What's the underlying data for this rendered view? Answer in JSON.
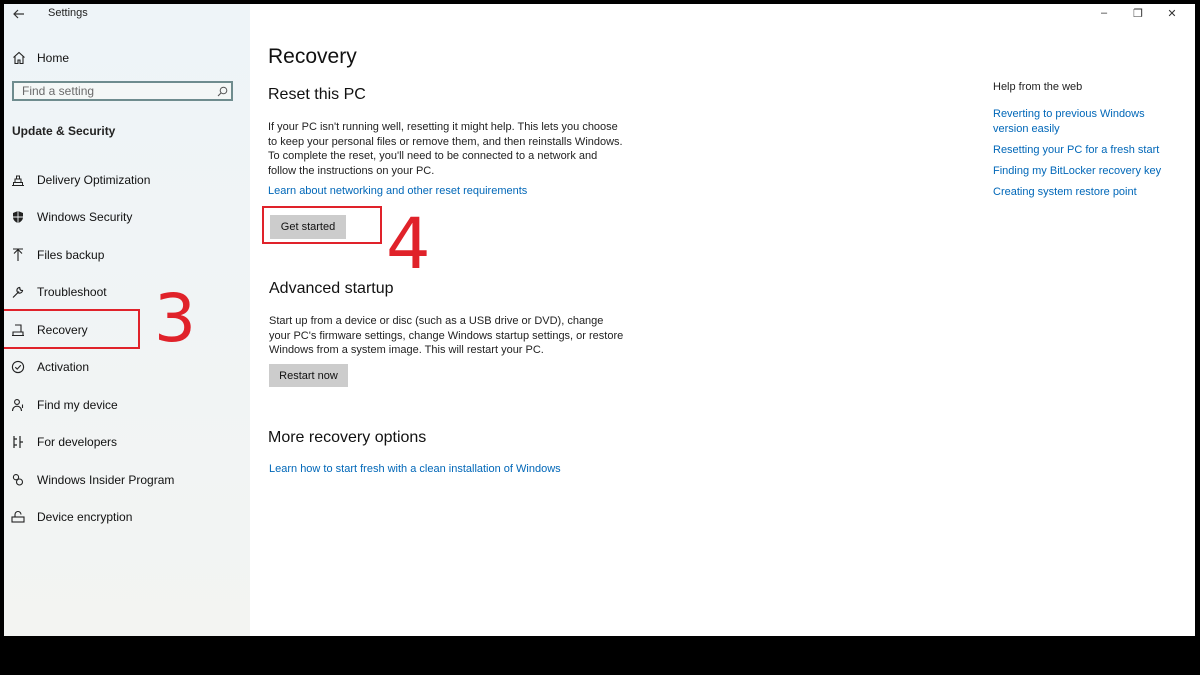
{
  "window": {
    "title": "Settings",
    "controls": [
      "–",
      "❐",
      "✕"
    ]
  },
  "sidebar": {
    "home_label": "Home",
    "search_placeholder": "Find a setting",
    "section_title": "Update & Security",
    "items": [
      {
        "label": "Delivery Optimization",
        "icon": "delivery-icon"
      },
      {
        "label": "Windows Security",
        "icon": "shield-icon"
      },
      {
        "label": "Files backup",
        "icon": "backup-arrow-icon"
      },
      {
        "label": "Troubleshoot",
        "icon": "wrench-icon"
      },
      {
        "label": "Recovery",
        "icon": "recovery-icon"
      },
      {
        "label": "Activation",
        "icon": "check-circle-icon"
      },
      {
        "label": "Find my device",
        "icon": "person-location-icon"
      },
      {
        "label": "For developers",
        "icon": "developer-icon"
      },
      {
        "label": "Windows Insider Program",
        "icon": "insider-icon"
      },
      {
        "label": "Device encryption",
        "icon": "encryption-icon"
      }
    ]
  },
  "main": {
    "title": "Recovery",
    "reset": {
      "heading": "Reset this PC",
      "description": "If your PC isn't running well, resetting it might help. This lets you choose to keep your personal files or remove them, and then reinstalls Windows. To complete the reset, you'll need to be connected to a network and follow the instructions on your PC.",
      "link": "Learn about networking and other reset requirements",
      "button": "Get started"
    },
    "advanced": {
      "heading": "Advanced startup",
      "description": "Start up from a device or disc (such as a USB drive or DVD), change your PC's firmware settings, change Windows startup settings, or restore Windows from a system image. This will restart your PC.",
      "button": "Restart now"
    },
    "more": {
      "heading": "More recovery options",
      "link": "Learn how to start fresh with a clean installation of Windows"
    }
  },
  "help": {
    "title": "Help from the web",
    "links": [
      "Reverting to previous Windows version easily",
      "Resetting your PC for a fresh start",
      "Finding my BitLocker recovery key",
      "Creating system restore point"
    ]
  },
  "annotations": {
    "step_recovery": "3",
    "step_get_started": "4",
    "color": "#e0222a"
  },
  "colors": {
    "link": "#0067b8",
    "button": "#cccccc"
  }
}
